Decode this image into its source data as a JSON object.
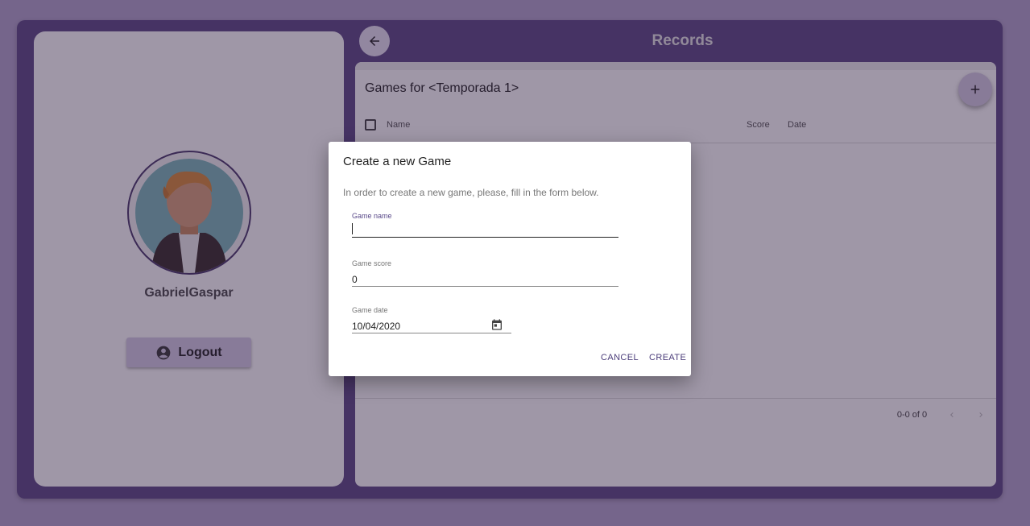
{
  "colors": {
    "page_bg": "#b3a4cc",
    "frame": "#5d4a85",
    "accent": "#5a4a8a",
    "button_bg": "#d6cde6"
  },
  "profile": {
    "username": "GabrielGaspar",
    "avatar_icon": "person-avatar",
    "logout_label": "Logout",
    "logout_icon": "account-circle-icon"
  },
  "header": {
    "back_icon": "arrow-left-icon",
    "title": "Records"
  },
  "games": {
    "title": "Games for <Temporada 1>",
    "add_icon": "plus-icon",
    "columns": [
      "Name",
      "Score",
      "Date"
    ],
    "pagination": "0-0 of 0"
  },
  "dialog": {
    "title": "Create a new Game",
    "description": "In order to create a new game, please, fill in the form below.",
    "fields": {
      "name": {
        "label": "Game name",
        "value": ""
      },
      "score": {
        "label": "Game score",
        "value": "0"
      },
      "date": {
        "label": "Game date",
        "value": "10/04/2020",
        "icon": "calendar-icon"
      }
    },
    "cancel_label": "CANCEL",
    "create_label": "CREATE"
  }
}
